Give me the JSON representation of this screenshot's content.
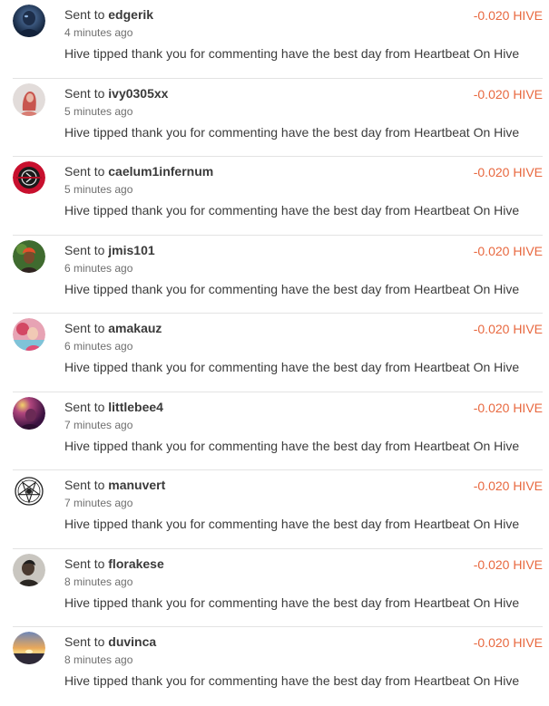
{
  "transfers": [
    {
      "prefix": "Sent to",
      "username": "edgerik",
      "time": "4 minutes ago",
      "amount": "-0.020 HIVE",
      "memo": "Hive tipped thank you for commenting have the best day from Heartbeat On Hive",
      "avatar_icon": "user-avatar-blue-figure-icon"
    },
    {
      "prefix": "Sent to",
      "username": "ivy0305xx",
      "time": "5 minutes ago",
      "amount": "-0.020 HIVE",
      "memo": "Hive tipped thank you for commenting have the best day from Heartbeat On Hive",
      "avatar_icon": "user-avatar-red-hair-icon"
    },
    {
      "prefix": "Sent to",
      "username": "caelum1infernum",
      "time": "5 minutes ago",
      "amount": "-0.020 HIVE",
      "memo": "Hive tipped thank you for commenting have the best day from Heartbeat On Hive",
      "avatar_icon": "user-avatar-red-emblem-icon"
    },
    {
      "prefix": "Sent to",
      "username": "jmis101",
      "time": "6 minutes ago",
      "amount": "-0.020 HIVE",
      "memo": "Hive tipped thank you for commenting have the best day from Heartbeat On Hive",
      "avatar_icon": "user-avatar-orange-headwrap-icon"
    },
    {
      "prefix": "Sent to",
      "username": "amakauz",
      "time": "6 minutes ago",
      "amount": "-0.020 HIVE",
      "memo": "Hive tipped thank you for commenting have the best day from Heartbeat On Hive",
      "avatar_icon": "user-avatar-pink-photo-icon"
    },
    {
      "prefix": "Sent to",
      "username": "littlebee4",
      "time": "7 minutes ago",
      "amount": "-0.020 HIVE",
      "memo": "Hive tipped thank you for commenting have the best day from Heartbeat On Hive",
      "avatar_icon": "user-avatar-purple-glow-icon"
    },
    {
      "prefix": "Sent to",
      "username": "manuvert",
      "time": "7 minutes ago",
      "amount": "-0.020 HIVE",
      "memo": "Hive tipped thank you for commenting have the best day from Heartbeat On Hive",
      "avatar_icon": "user-avatar-pentagram-icon"
    },
    {
      "prefix": "Sent to",
      "username": "florakese",
      "time": "8 minutes ago",
      "amount": "-0.020 HIVE",
      "memo": "Hive tipped thank you for commenting have the best day from Heartbeat On Hive",
      "avatar_icon": "user-avatar-profile-photo-icon"
    },
    {
      "prefix": "Sent to",
      "username": "duvinca",
      "time": "8 minutes ago",
      "amount": "-0.020 HIVE",
      "memo": "Hive tipped thank you for commenting have the best day from Heartbeat On Hive",
      "avatar_icon": "user-avatar-sunset-icon"
    }
  ],
  "colors": {
    "amount": "#e8683f",
    "divider": "#e3e3e3",
    "text": "#3b3b3b",
    "muted": "#6f6f6f"
  }
}
